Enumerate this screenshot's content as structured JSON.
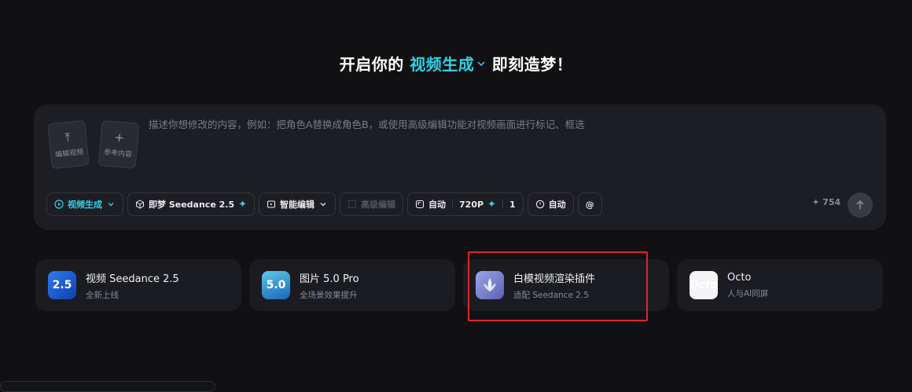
{
  "headline": {
    "prefix": "开启你的",
    "mode": "视频生成",
    "suffix": "即刻造梦！"
  },
  "composer": {
    "upload_video_label": "编辑视频",
    "reference_label": "参考内容",
    "prompt_placeholder": "描述你想修改的内容，例如：把角色A替换成角色B，或使用高级编辑功能对视频画面进行标记、框选",
    "toolbar": {
      "mode_label": "视频生成",
      "model_label": "即梦 Seedance 2.5",
      "smart_edit_label": "智能编辑",
      "advanced_edit_label": "高级编辑",
      "ratio_label": "自动",
      "resolution_label": "720P",
      "count_label": "1",
      "duration_label": "自动",
      "mention_label": "@"
    },
    "credits": "754"
  },
  "cards": [
    {
      "thumb": "2.5",
      "title": "视频 Seedance 2.5",
      "subtitle": "全新上线"
    },
    {
      "thumb": "5.0",
      "title": "图片 5.0 Pro",
      "subtitle": "全场景效果提升"
    },
    {
      "thumb": "",
      "title": "白模视频渲染插件",
      "subtitle": "适配 Seedance 2.5"
    },
    {
      "thumb": "Octo",
      "title": "Octo",
      "subtitle": "人与AI同屏"
    }
  ],
  "colors": {
    "accent": "#2fd3e6",
    "background": "#111114",
    "panel": "#1d1e24",
    "highlight": "#e0232a"
  }
}
